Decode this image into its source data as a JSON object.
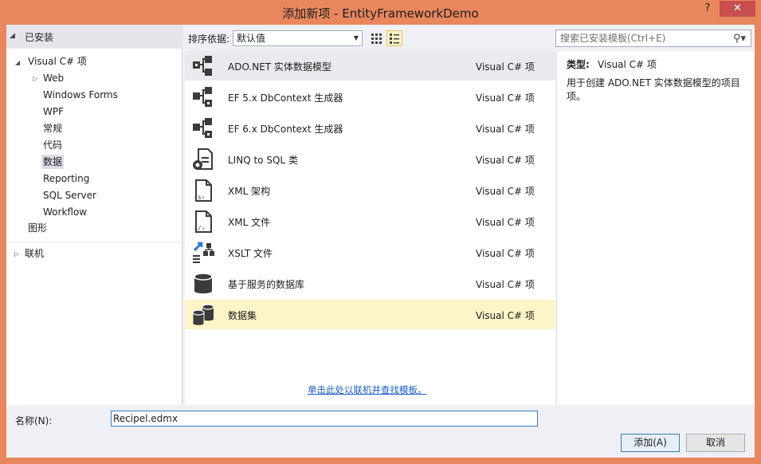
{
  "window": {
    "title": "添加新项 - EntityFrameworkDemo",
    "help_label": "?",
    "close_label": "✕"
  },
  "tree": {
    "header": "已安装",
    "root": "Visual C# 项",
    "items": [
      "Web",
      "Windows Forms",
      "WPF",
      "常规",
      "代码",
      "数据",
      "Reporting",
      "SQL Server",
      "Workflow"
    ],
    "graphics": "图形",
    "online": "联机"
  },
  "toolbar": {
    "sort_label": "排序依据:",
    "sort_value": "默认值",
    "search_placeholder": "搜索已安装模板(Ctrl+E)"
  },
  "templates": [
    {
      "name": "ADO.NET 实体数据模型",
      "lang": "Visual C# 项",
      "icon": "entity-model-icon"
    },
    {
      "name": "EF 5.x DbContext 生成器",
      "lang": "Visual C# 项",
      "icon": "dbcontext-generator-icon"
    },
    {
      "name": "EF 6.x DbContext 生成器",
      "lang": "Visual C# 项",
      "icon": "dbcontext-generator-icon"
    },
    {
      "name": "LINQ to SQL 类",
      "lang": "Visual C# 项",
      "icon": "linq-to-sql-icon"
    },
    {
      "name": "XML 架构",
      "lang": "Visual C# 项",
      "icon": "xml-schema-icon"
    },
    {
      "name": "XML 文件",
      "lang": "Visual C# 项",
      "icon": "xml-file-icon"
    },
    {
      "name": "XSLT 文件",
      "lang": "Visual C# 项",
      "icon": "xslt-file-icon"
    },
    {
      "name": "基于服务的数据库",
      "lang": "Visual C# 项",
      "icon": "database-icon"
    },
    {
      "name": "数据集",
      "lang": "Visual C# 项",
      "icon": "dataset-icon"
    }
  ],
  "online_link": "单击此处以联机并查找模板。",
  "details": {
    "type_label": "类型:",
    "type_value": "Visual C# 项",
    "description": "用于创建 ADO.NET 实体数据模型的项目项。"
  },
  "form": {
    "name_label": "名称(N):",
    "name_value": "Recipel.edmx",
    "add_button": "添加(A)",
    "cancel_button": "取消"
  },
  "colors": {
    "title_bar": "#e8865d",
    "selected_row": "#fdf4c8",
    "link": "#1a5ccc"
  }
}
